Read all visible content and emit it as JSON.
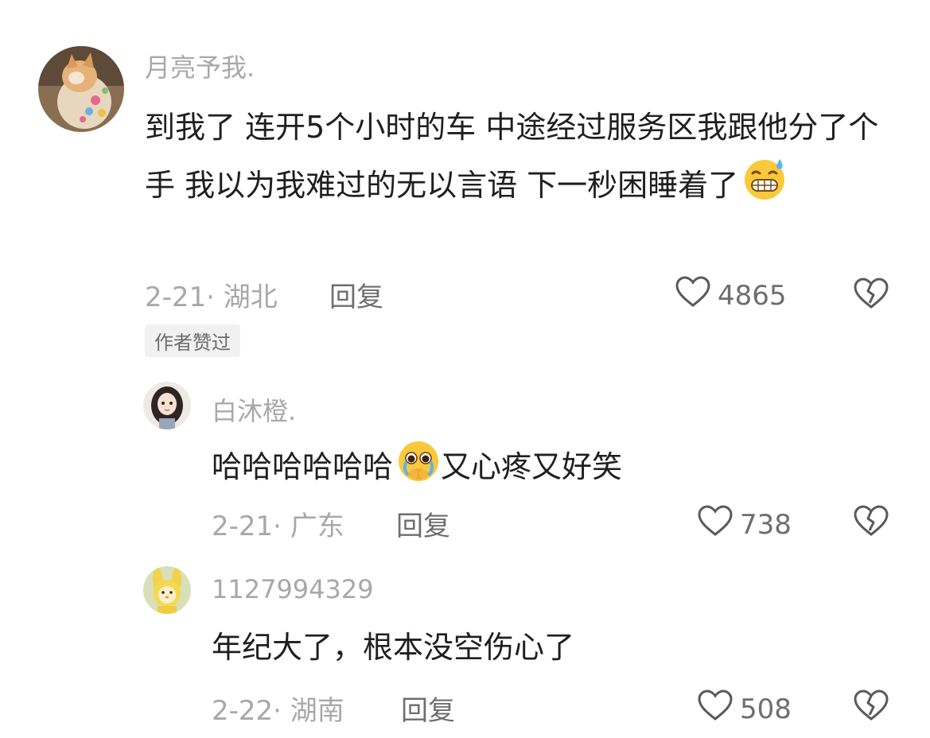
{
  "comment": {
    "username": "月亮予我.",
    "avatar_icon": "cat-avatar-icon",
    "text": "到我了 连开5个小时的车 中途经过服务区我跟他分了个手 我以为我难过的无以言语 下一秒困睡着了",
    "emoji_icon": "grimacing-sweat-emoji-icon",
    "date_location": "2-21· 湖北",
    "reply_label": "回复",
    "likes": "4865",
    "author_badge": "作者赞过"
  },
  "replies": [
    {
      "username": "白沐橙.",
      "avatar_icon": "girl-avatar-icon",
      "text_before": "哈哈哈哈哈哈",
      "emoji_icon": "crying-pleading-emoji-icon",
      "text_after": "又心疼又好笑",
      "date_location": "2-21· 广东",
      "reply_label": "回复",
      "likes": "738"
    },
    {
      "username": "1127994329",
      "avatar_icon": "yellow-bunny-avatar-icon",
      "text": "年纪大了，根本没空伤心了",
      "date_location": "2-22· 湖南",
      "reply_label": "回复",
      "likes": "508"
    }
  ],
  "colors": {
    "secondary_text": "#a8a8a8",
    "primary_text": "#1f1f1f",
    "icon_stroke": "#5a5a5a"
  }
}
